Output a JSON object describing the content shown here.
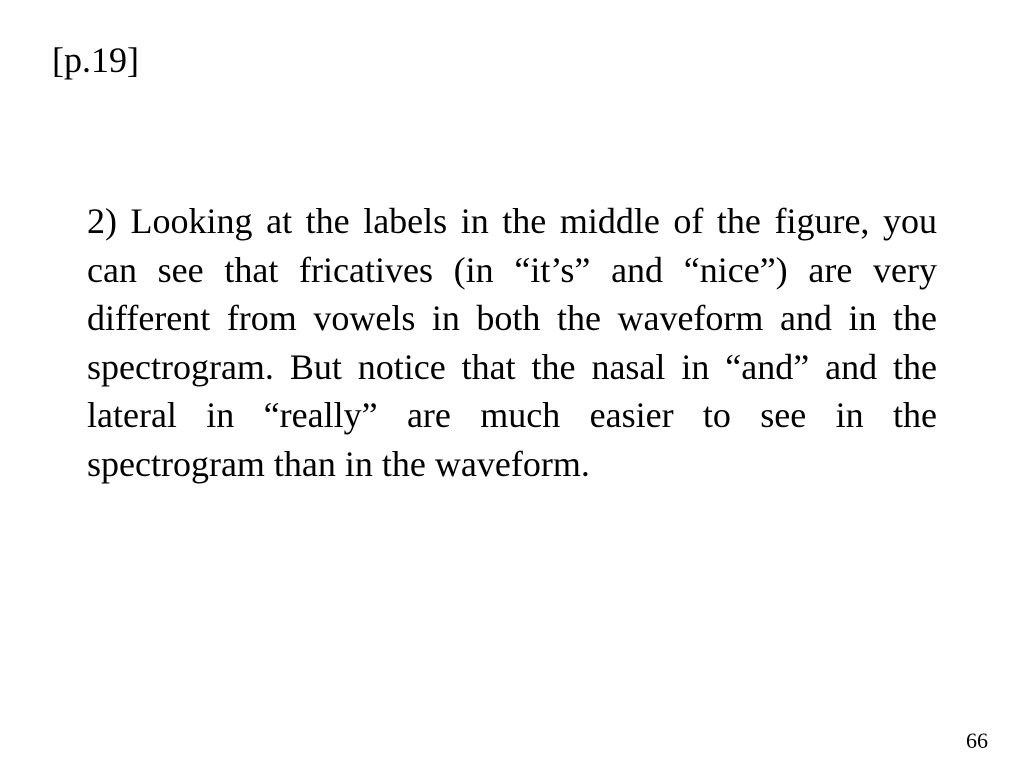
{
  "slide": {
    "page_ref": "[p.19]",
    "body": "2) Looking at the labels in the middle of the figure, you can see that fricatives (in “it’s” and “nice”) are very different from vowels in both the waveform and in the spectrogram. But notice that the nasal in “and” and the lateral in “really” are much easier to see in the spectrogram than in the waveform.",
    "page_number": "66"
  }
}
